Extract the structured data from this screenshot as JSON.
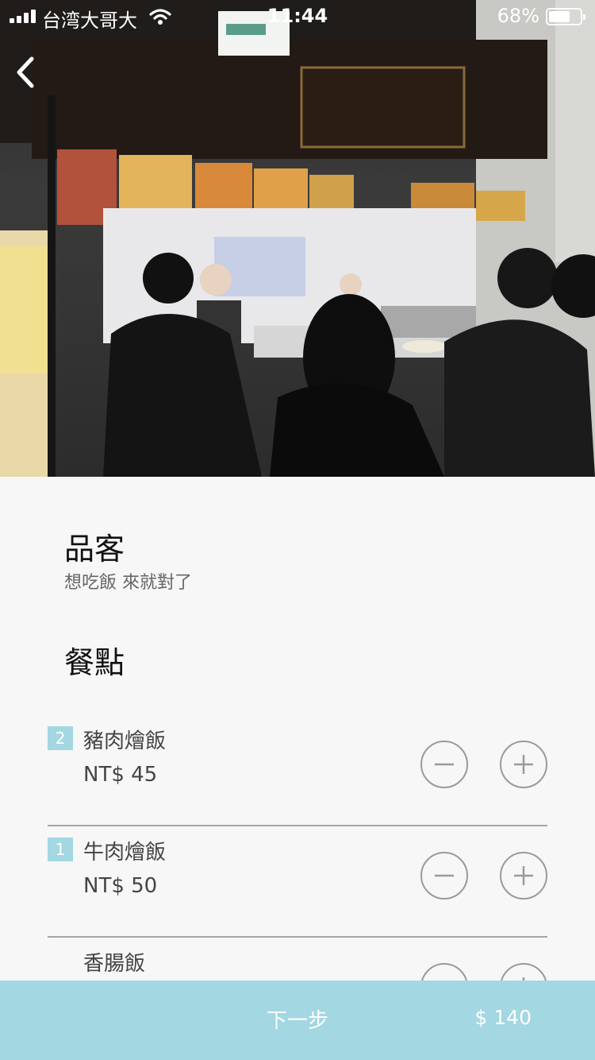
{
  "status_bar": {
    "carrier": "台湾大哥大",
    "time": "11:44",
    "battery_percent": "68%",
    "battery_level": 0.68
  },
  "store": {
    "name": "品客",
    "tagline": "想吃飯 來就對了"
  },
  "menu": {
    "section_title": "餐點",
    "items": [
      {
        "quantity": "2",
        "name": "豬肉燴飯",
        "price": "NT$ 45"
      },
      {
        "quantity": "1",
        "name": "牛肉燴飯",
        "price": "NT$ 50"
      },
      {
        "quantity": "",
        "name": "香腸飯",
        "price": ""
      }
    ]
  },
  "bottom_bar": {
    "next_label": "下一步",
    "total": "$ 140"
  },
  "colors": {
    "accent": "#a3d7e2",
    "divider": "#a5a5a5",
    "background": "#f7f7f7"
  }
}
